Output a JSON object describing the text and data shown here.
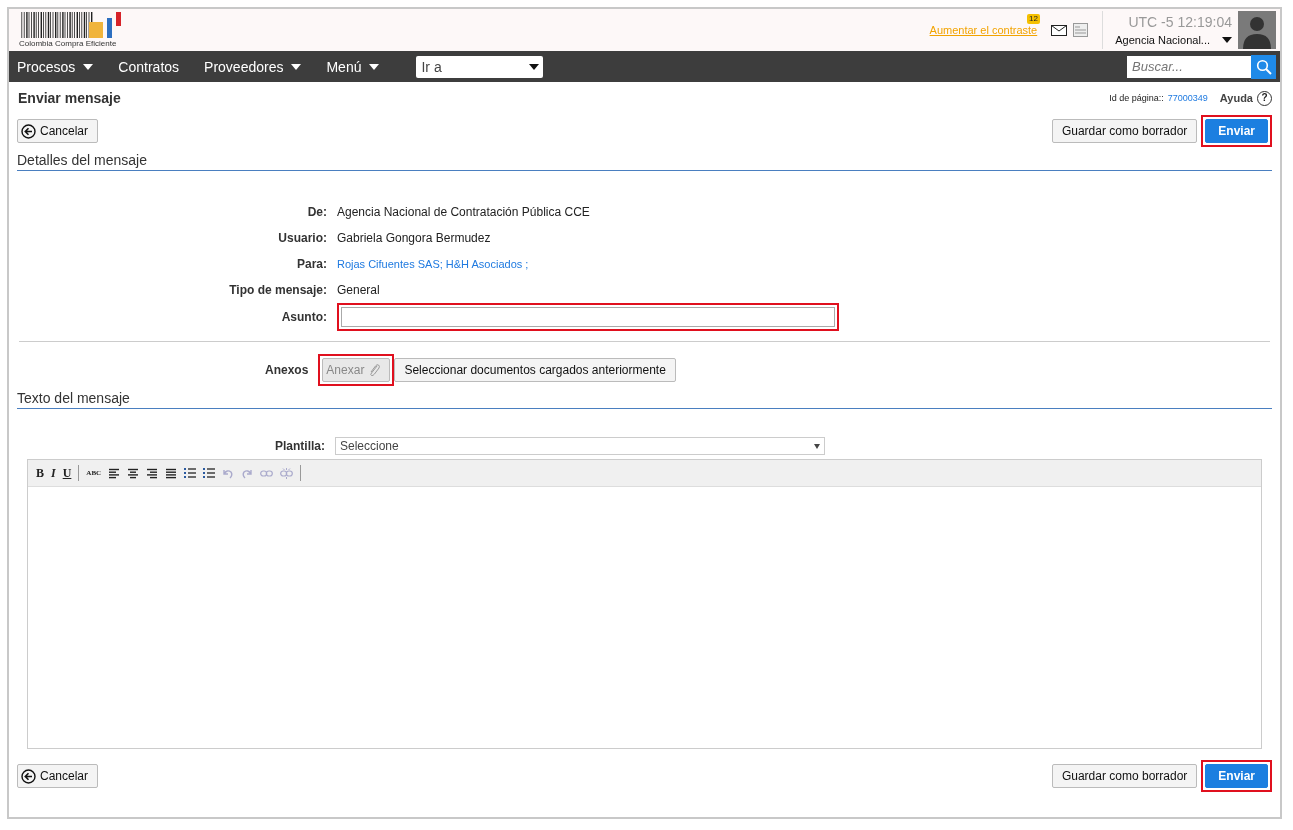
{
  "header": {
    "logo_text": "Colombia Compra Eficiente",
    "contrast_link": "Aumentar el contraste",
    "mail_count": "12",
    "timezone": "UTC -5",
    "time": "12:19:04",
    "account": "Agencia Nacional..."
  },
  "nav": {
    "items": [
      {
        "label": "Procesos",
        "dropdown": true
      },
      {
        "label": "Contratos",
        "dropdown": false
      },
      {
        "label": "Proveedores",
        "dropdown": true
      },
      {
        "label": "Menú",
        "dropdown": true
      }
    ],
    "goto": "Ir a",
    "search_placeholder": "Buscar..."
  },
  "page": {
    "title": "Enviar mensaje",
    "page_id_label": "Id de página::",
    "page_id": "77000349",
    "help": "Ayuda",
    "help_icon": "?"
  },
  "actions": {
    "cancel": "Cancelar",
    "draft": "Guardar como borrador",
    "send": "Enviar",
    "send_highlighted": true
  },
  "details": {
    "heading": "Detalles del mensaje",
    "fields": [
      {
        "label": "De:",
        "kind": "text",
        "value": "Agencia Nacional de Contratación Pública CCE"
      },
      {
        "label": "Usuario:",
        "kind": "text",
        "value": "Gabriela Gongora Bermudez"
      },
      {
        "label": "Para:",
        "kind": "link",
        "value": "Rojas Cifuentes SAS; H&H Asociados ;"
      },
      {
        "label": "Tipo de mensaje:",
        "kind": "text",
        "value": "General"
      },
      {
        "label": "Asunto:",
        "kind": "input",
        "highlighted": true
      }
    ],
    "attachments_label": "Anexos",
    "attach_button": "Anexar",
    "attach_highlighted": true,
    "attach_disabled": true,
    "select_docs": "Seleccionar documentos cargados anteriormente"
  },
  "body": {
    "heading": "Texto del mensaje",
    "template_label": "Plantilla:",
    "template_value": "Seleccione",
    "tools": [
      {
        "kind": "bold",
        "label": "B",
        "disabled": false
      },
      {
        "kind": "italic",
        "label": "I",
        "disabled": false
      },
      {
        "kind": "underline",
        "label": "U",
        "disabled": false
      },
      {
        "kind": "sep"
      },
      {
        "kind": "spell",
        "label": "ABC",
        "disabled": false
      },
      {
        "kind": "align-left",
        "disabled": false
      },
      {
        "kind": "align-center",
        "disabled": false
      },
      {
        "kind": "align-right",
        "disabled": false
      },
      {
        "kind": "justify",
        "disabled": false
      },
      {
        "kind": "bullets",
        "disabled": false
      },
      {
        "kind": "numbers",
        "disabled": false
      },
      {
        "kind": "undo",
        "disabled": true
      },
      {
        "kind": "redo",
        "disabled": true
      },
      {
        "kind": "link",
        "disabled": true
      },
      {
        "kind": "unlink",
        "disabled": true
      },
      {
        "kind": "sep"
      }
    ]
  },
  "footer_actions": {
    "cancel": "Cancelar",
    "draft": "Guardar como borrador",
    "send": "Enviar",
    "send_highlighted": true
  }
}
